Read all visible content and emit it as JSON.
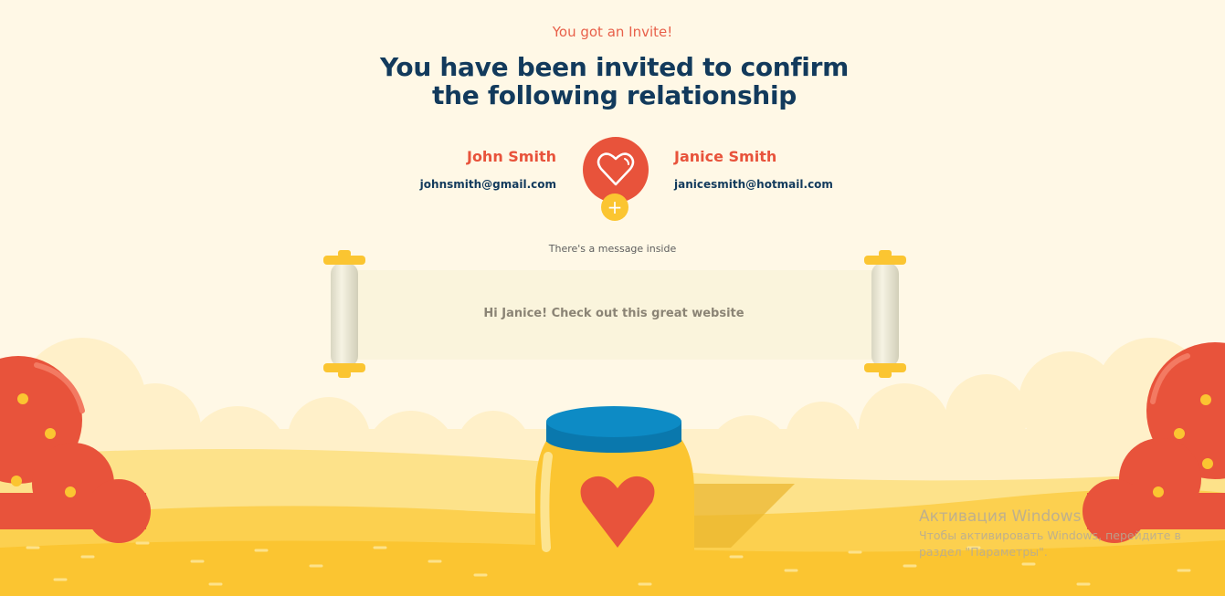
{
  "invite": {
    "eyebrow": "You got an Invite!",
    "headline_line1": "You have been invited to confirm",
    "headline_line2": "the following relationship"
  },
  "sender": {
    "name": "John Smith",
    "email": "johnsmith@gmail.com"
  },
  "recipient": {
    "name": "Janice Smith",
    "email": "janicesmith@hotmail.com"
  },
  "badge": {
    "icon": "heart-icon",
    "plus_label": "+"
  },
  "message": {
    "caption": "There's a message inside",
    "text": "Hi Janice! Check out this great website"
  },
  "watermark": {
    "title": "Активация Windows",
    "line1": "Чтобы активировать Windows, перейдите в",
    "line2": "раздел \"Параметры\"."
  },
  "colors": {
    "background": "#fff8e6",
    "accent_red": "#e8533b",
    "navy": "#123a5c",
    "yellow": "#fbc531",
    "jar_lid_blue": "#0d8bc5"
  }
}
